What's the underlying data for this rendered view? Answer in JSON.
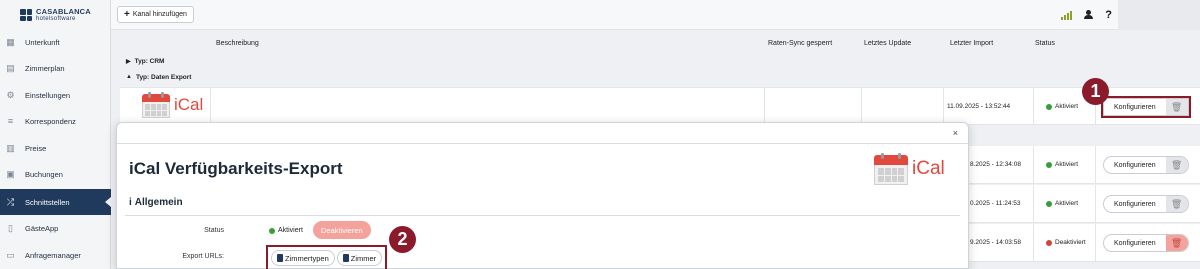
{
  "app": {
    "logo_line1": "CASABLANCA",
    "logo_line2": "hotelsoftware"
  },
  "sidebar": {
    "items": [
      {
        "label": "Unterkunft",
        "icon": "building-icon"
      },
      {
        "label": "Zimmerplan",
        "icon": "calendar-grid-icon"
      },
      {
        "label": "Einstellungen",
        "icon": "gears-icon"
      },
      {
        "label": "Korrespondenz",
        "icon": "mail-icon"
      },
      {
        "label": "Preise",
        "icon": "price-icon"
      },
      {
        "label": "Buchungen",
        "icon": "bookings-icon"
      },
      {
        "label": "Schnittstellen",
        "icon": "shuffle-icon",
        "active": true
      },
      {
        "label": "GästeApp",
        "icon": "phone-icon"
      },
      {
        "label": "Anfragemanager",
        "icon": "inbox-icon"
      }
    ]
  },
  "toolbar": {
    "add_channel_label": "Kanal hinzufügen"
  },
  "table": {
    "headers": {
      "beschreibung": "Beschreibung",
      "raten_sync": "Raten-Sync gesperrt",
      "letztes_update": "Letztes Update",
      "letzter_import": "Letzter Import",
      "status": "Status"
    },
    "groups": [
      {
        "label": "Typ: CRM",
        "expanded": false
      },
      {
        "label": "Typ: Daten Export",
        "expanded": true
      }
    ],
    "rows": [
      {
        "import": "11.09.2025 - 13:52:44",
        "status": "Aktiviert",
        "status_color": "#3a9d3a",
        "action": "Konfigurieren"
      },
      {
        "import": "8.2025 - 12:34:08",
        "status": "Aktiviert",
        "status_color": "#3a9d3a",
        "action": "Konfigurieren"
      },
      {
        "import": "0.2025 - 11:24:53",
        "status": "Aktiviert",
        "status_color": "#3a9d3a",
        "action": "Konfigurieren"
      },
      {
        "import": "9.2025 - 14:03:58",
        "status": "Deaktiviert",
        "status_color": "#d0453c",
        "action": "Konfigurieren"
      }
    ]
  },
  "ical_label": "iCal",
  "modal": {
    "close": "×",
    "title": "iCal Verfügbarkeits-Export",
    "section_icon": "i",
    "section_title": "Allgemein",
    "status_label": "Status",
    "status_value": "Aktiviert",
    "deactivate_label": "Deaktivieren",
    "export_label": "Export URLs:",
    "export_buttons": [
      "Zimmertypen",
      "Zimmer"
    ]
  },
  "annotations": {
    "badge1": "1",
    "badge2": "2"
  },
  "colors": {
    "primary": "#1f3a5c",
    "accent_red": "#e2493e",
    "highlight": "#8b1a2b",
    "active_green": "#3a9d3a"
  }
}
